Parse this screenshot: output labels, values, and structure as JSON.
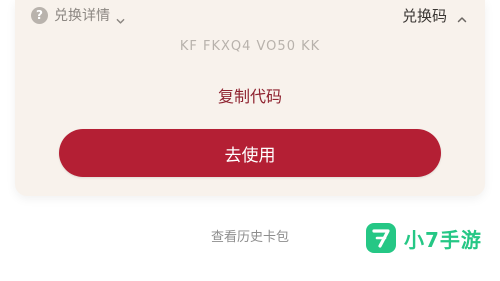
{
  "card": {
    "details_label": "兑换详情",
    "help_icon_glyph": "?",
    "code_toggle_label": "兑换码",
    "code_value": "KF FKXQ4 VO50 KK",
    "copy_label": "复制代码",
    "use_label": "去使用"
  },
  "footer": {
    "history_link": "查看历史卡包"
  },
  "watermark": {
    "logo_glyph": "7",
    "text": "小7手游"
  },
  "colors": {
    "primary": "#b41f34",
    "copy_text": "#8f2330",
    "card_bg": "#f8f2ec",
    "watermark_green": "#25c785"
  },
  "icons": {
    "help": "question-circle-icon",
    "details_chevron": "chevron-down-icon",
    "toggle_chevron": "chevron-up-icon"
  }
}
